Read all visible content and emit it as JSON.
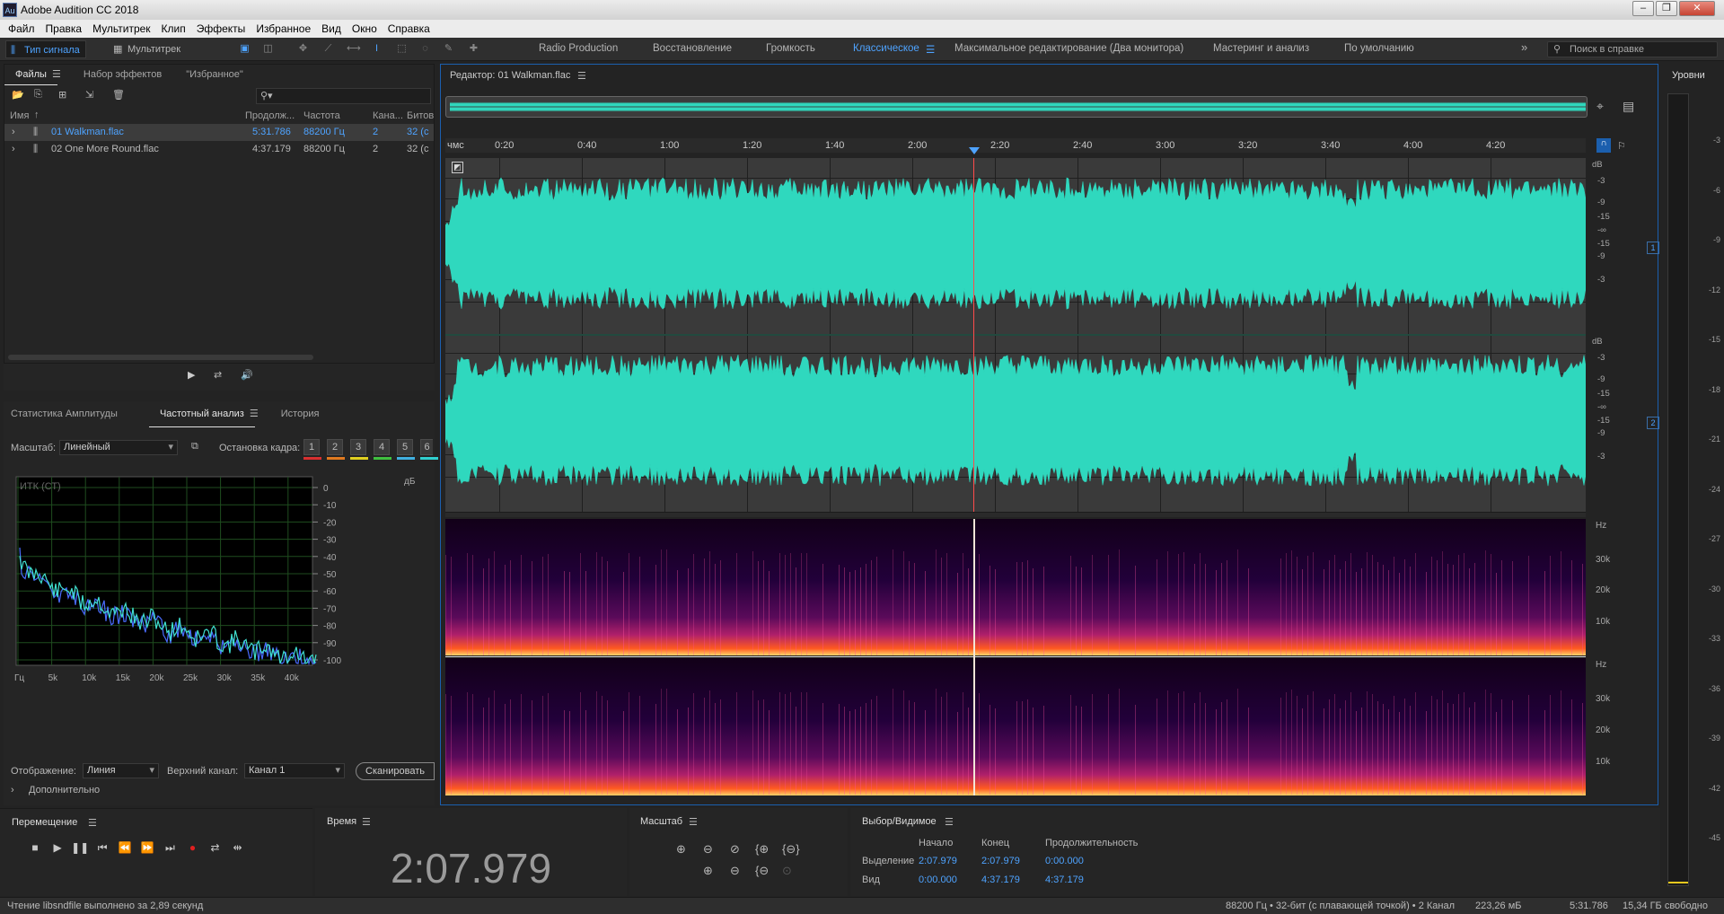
{
  "window": {
    "title": "Adobe Audition CC 2018",
    "icon": "Au"
  },
  "menu": [
    "Файл",
    "Правка",
    "Мультитрек",
    "Клип",
    "Эффекты",
    "Избранное",
    "Вид",
    "Окно",
    "Справка"
  ],
  "toolbar": {
    "mode_waveform": "Тип сигнала",
    "mode_multitrack": "Мультитрек",
    "workspaces": [
      "Radio Production",
      "Восстановление",
      "Громкость",
      "Классическое",
      "Максимальное редактирование (Два монитора)",
      "Мастеринг и анализ",
      "По умолчанию"
    ],
    "active_workspace": "Классическое",
    "help_placeholder": "Поиск в справке"
  },
  "files_panel": {
    "tabs": [
      "Файлы",
      "Набор эффектов",
      "\"Избранное\""
    ],
    "columns": [
      "Имя",
      "Продолж...",
      "Частота",
      "Кана...",
      "Битов"
    ],
    "rows": [
      {
        "name": "01 Walkman.flac",
        "duration": "5:31.786",
        "rate": "88200 Гц",
        "channels": "2",
        "bits": "32 (с",
        "selected": true
      },
      {
        "name": "02 One More Round.flac",
        "duration": "4:37.179",
        "rate": "88200 Гц",
        "channels": "2",
        "bits": "32 (с",
        "selected": false
      }
    ]
  },
  "freq_panel": {
    "tabs": [
      "Статистика Амплитуды",
      "Частотный анализ",
      "История"
    ],
    "scale_label": "Масштаб:",
    "scale_value": "Линейный",
    "freeze_label": "Остановка кадра:",
    "freeze_buttons": [
      "1",
      "2",
      "3",
      "4",
      "5",
      "6"
    ],
    "freeze_colors": [
      "#d93030",
      "#e07a20",
      "#e0d020",
      "#40c040",
      "#40b0e0",
      "#30d0d0"
    ],
    "plot_label": "ИТК (СТ)",
    "db_unit": "дБ",
    "db_ticks": [
      "0",
      "-10",
      "-20",
      "-30",
      "-40",
      "-50",
      "-60",
      "-70",
      "-80",
      "-90",
      "-100"
    ],
    "hz_ticks": [
      "Гц",
      "5k",
      "10k",
      "15k",
      "20k",
      "25k",
      "30k",
      "35k",
      "40k"
    ],
    "display_label": "Отображение:",
    "display_value": "Линия",
    "channel_label": "Верхний канал:",
    "channel_value": "Канал 1",
    "scan_button": "Сканировать",
    "advanced_label": "Дополнительно"
  },
  "editor": {
    "title": "Редактор: 01 Walkman.flac",
    "ruler_unit": "чмс",
    "ruler_ticks": [
      "0:20",
      "0:40",
      "1:00",
      "1:20",
      "1:40",
      "2:00",
      "2:20",
      "2:40",
      "3:00",
      "3:20",
      "3:40",
      "4:00",
      "4:20"
    ],
    "db_ticks_ch": [
      "dB",
      "-3",
      "-9",
      "-15",
      "-∞",
      "-15",
      "-9",
      "-3"
    ],
    "channels": [
      "1",
      "2"
    ],
    "hz_ticks": [
      "Hz",
      "30k",
      "20k",
      "10k"
    ],
    "waveform_color": "#2fd8be",
    "playhead_color": "#ff4a4a"
  },
  "levels": {
    "title": "Уровни",
    "ticks": [
      "-3",
      "-6",
      "-9",
      "-12",
      "-15",
      "-18",
      "-21",
      "-24",
      "-27",
      "-30",
      "-33",
      "-36",
      "-39",
      "-42",
      "-45"
    ]
  },
  "transport": {
    "title": "Перемещение"
  },
  "time": {
    "title": "Время",
    "value": "2:07.979"
  },
  "zoom": {
    "title": "Масштаб"
  },
  "selection": {
    "title": "Выбор/Видимое",
    "headers": [
      "Начало",
      "Конец",
      "Продолжительность"
    ],
    "rows": [
      {
        "label": "Выделение",
        "start": "2:07.979",
        "end": "2:07.979",
        "duration": "0:00.000"
      },
      {
        "label": "Вид",
        "start": "0:00.000",
        "end": "4:37.179",
        "duration": "4:37.179"
      }
    ]
  },
  "status": {
    "message": "Чтение libsndfile выполнено за 2,89 секунд",
    "format": "88200 Гц • 32-бит (с плавающей точкой) • 2 Канал",
    "size": "223,26 мБ",
    "duration": "5:31.786",
    "free": "15,34 ГБ свободно"
  }
}
